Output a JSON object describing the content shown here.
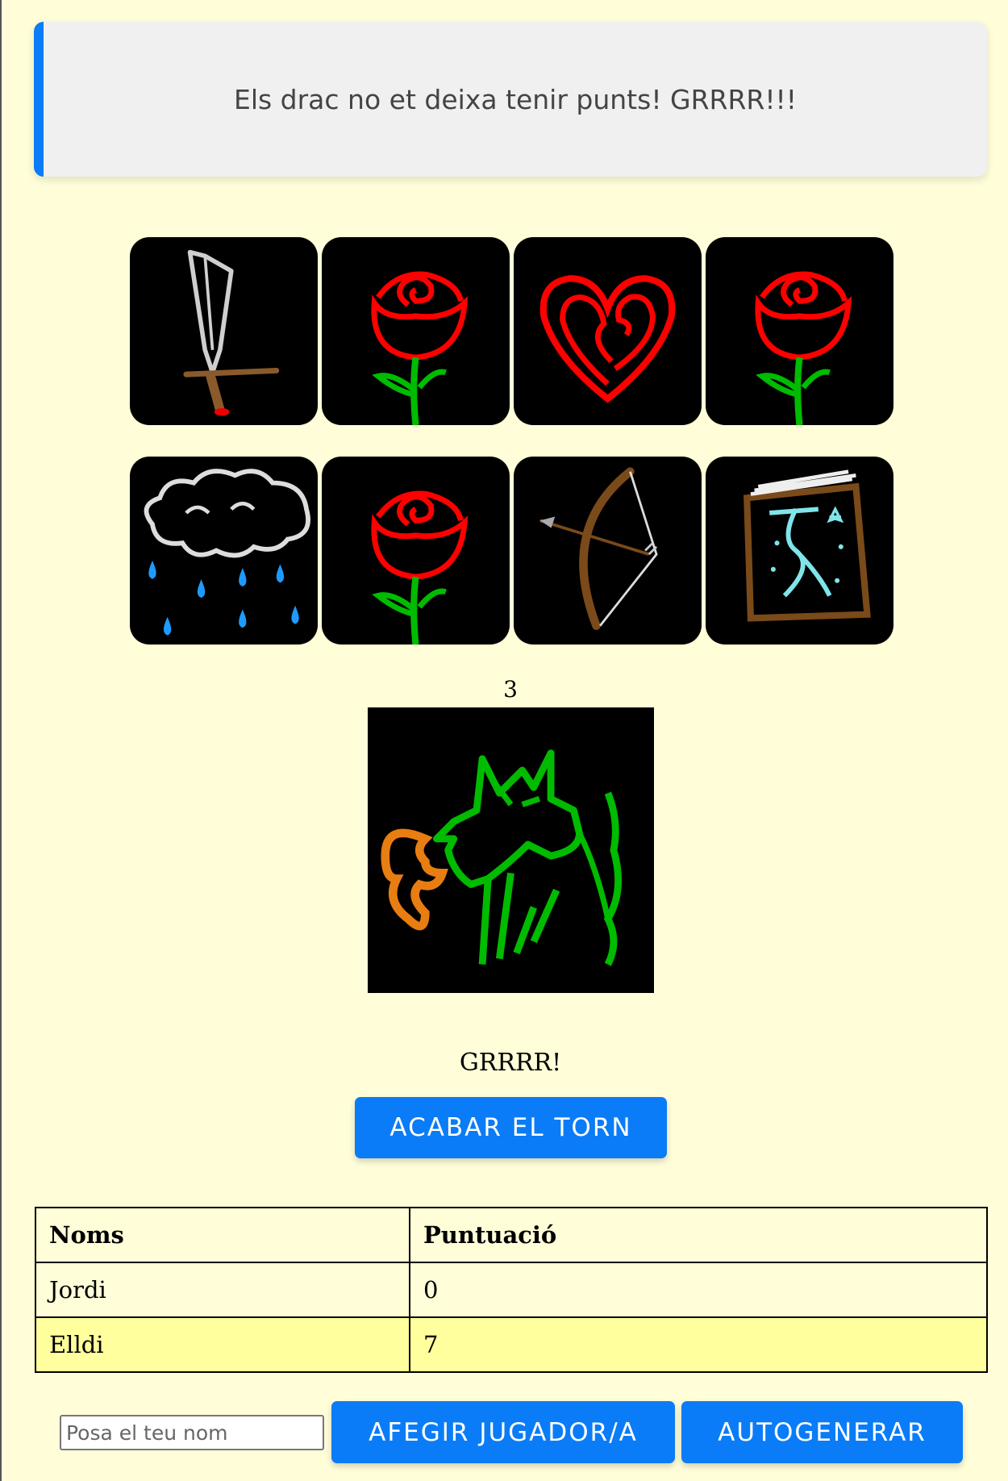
{
  "banner": {
    "message": "Els drac no et deixa tenir punts! GRRRR!!!"
  },
  "cards": [
    {
      "icon": "sword-icon"
    },
    {
      "icon": "rose-icon"
    },
    {
      "icon": "heart-icon"
    },
    {
      "icon": "rose-icon"
    },
    {
      "icon": "rain-cloud-icon"
    },
    {
      "icon": "rose-icon"
    },
    {
      "icon": "bow-arrow-icon"
    },
    {
      "icon": "spellbook-icon"
    }
  ],
  "dragon": {
    "counter": "3",
    "icon": "dragon-icon",
    "caption": "GRRRR!"
  },
  "actions": {
    "end_turn_label": "Acabar el torn",
    "add_player_label": "Afegir jugador/a",
    "autogenerate_label": "Autogenerar",
    "name_placeholder": "Posa el teu nom"
  },
  "scoreboard": {
    "headers": {
      "name": "Noms",
      "score": "Puntuació"
    },
    "rows": [
      {
        "name": "Jordi",
        "score": "0"
      },
      {
        "name": "Elldi",
        "score": "7"
      }
    ]
  },
  "colors": {
    "background": "#fffed9",
    "accent": "#0a7cf7",
    "highlight_row": "#ffff9e",
    "card_bg": "#000000"
  }
}
